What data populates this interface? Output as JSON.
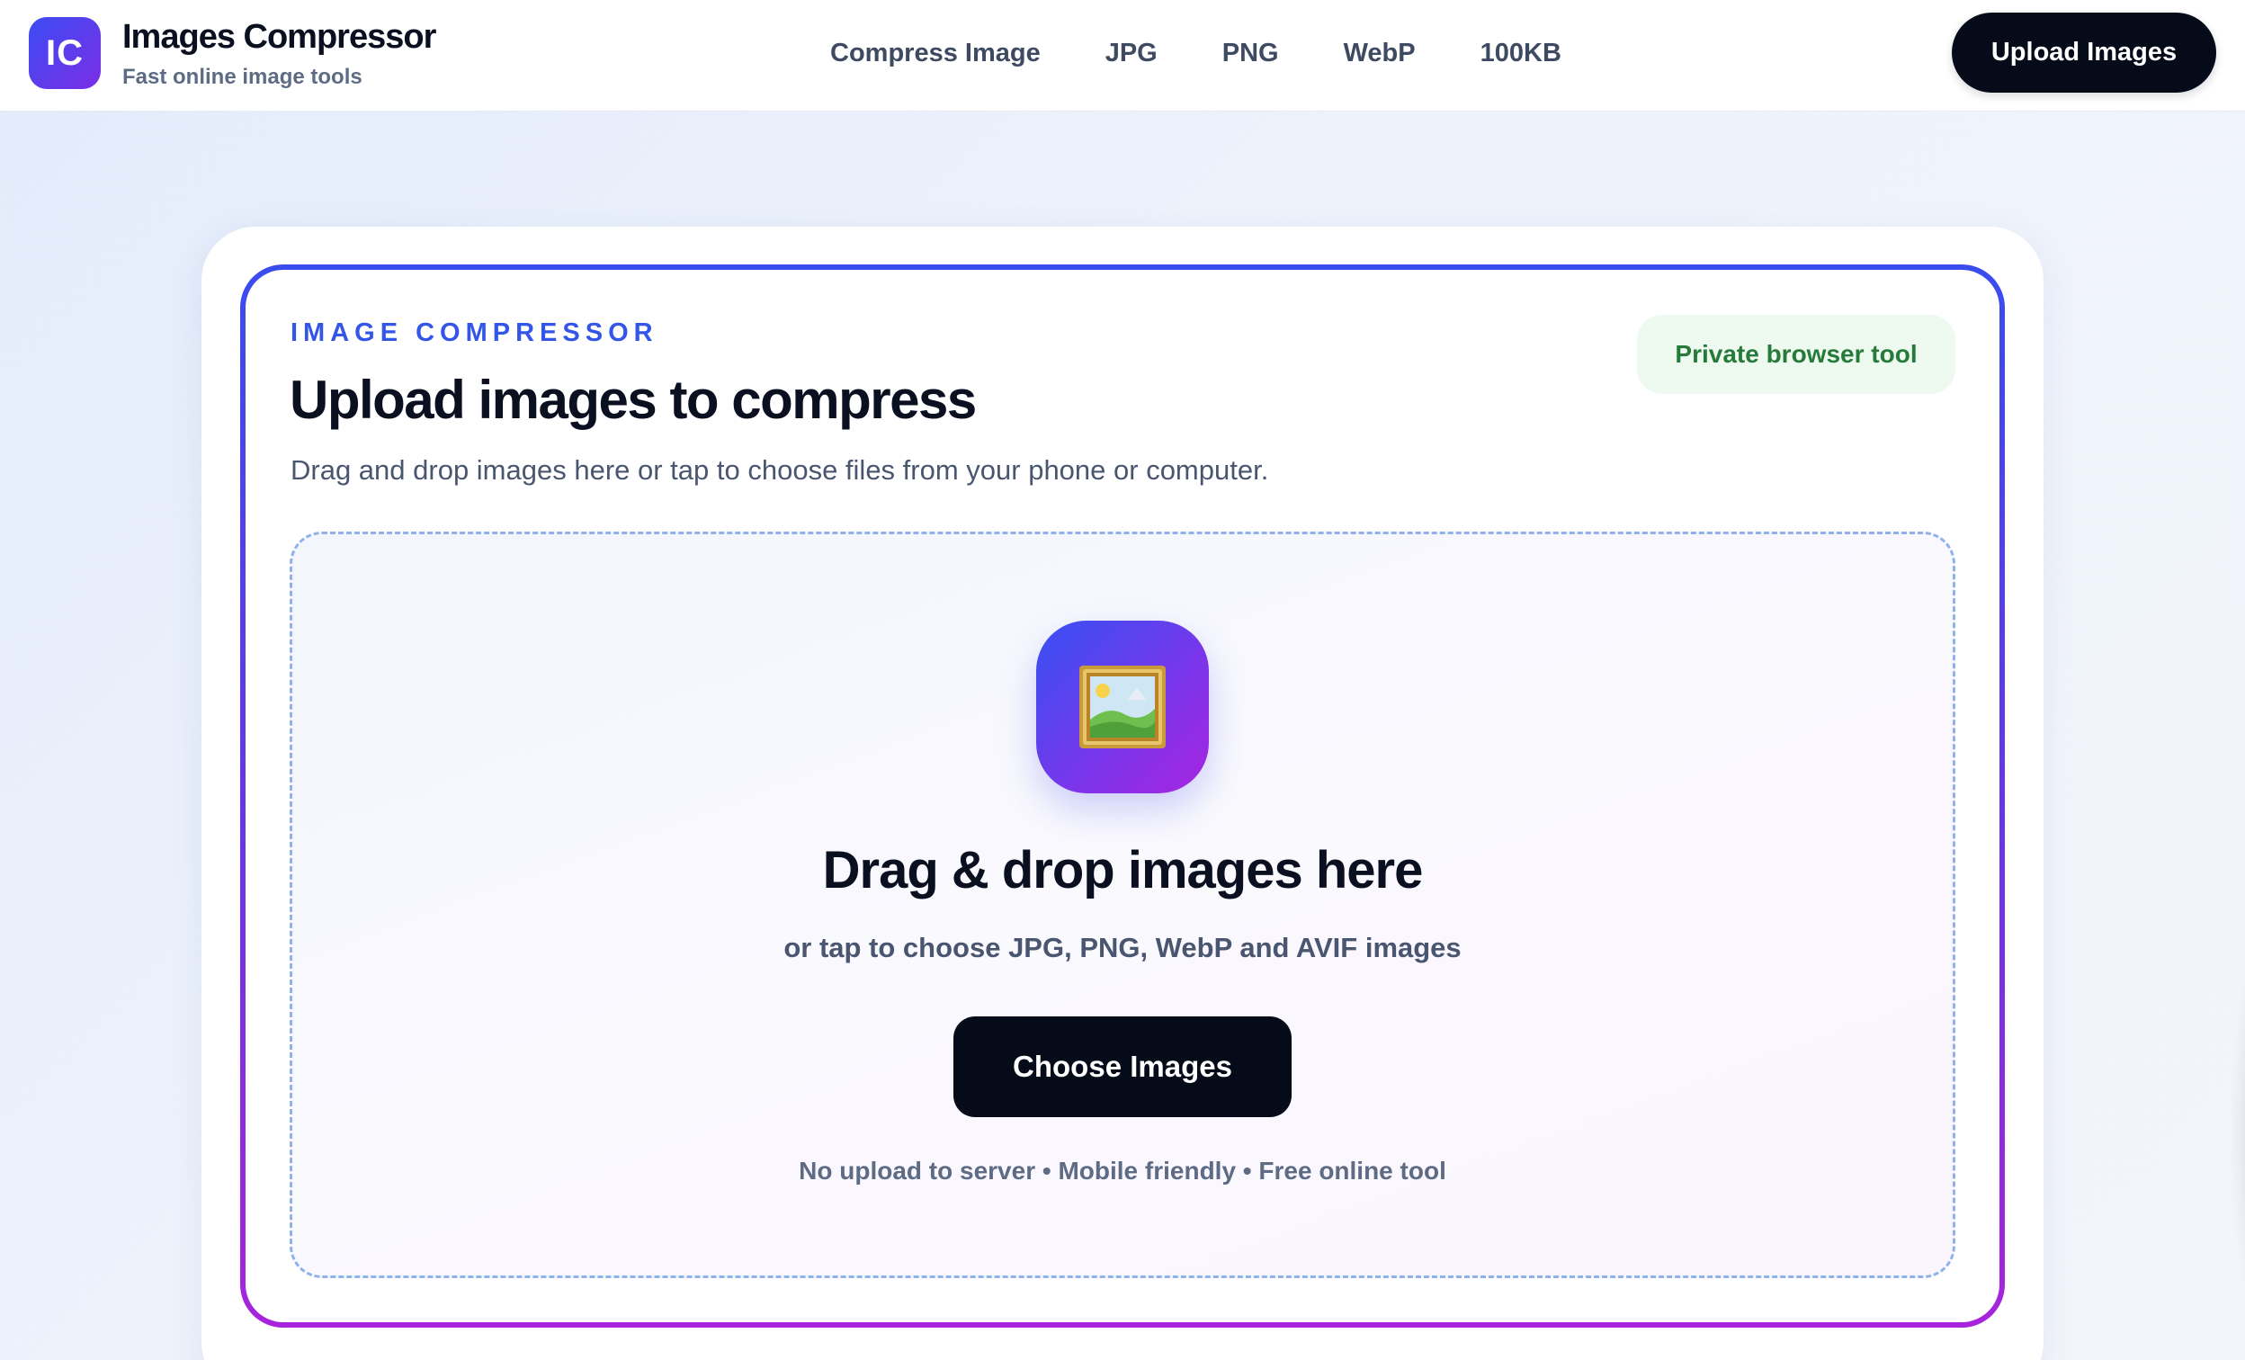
{
  "header": {
    "logo_text": "IC",
    "brand_title": "Images Compressor",
    "brand_subtitle": "Fast online image tools",
    "nav": [
      {
        "label": "Compress Image"
      },
      {
        "label": "JPG"
      },
      {
        "label": "PNG"
      },
      {
        "label": "WebP"
      },
      {
        "label": "100KB"
      }
    ],
    "upload_button": "Upload Images"
  },
  "main": {
    "eyebrow": "IMAGE COMPRESSOR",
    "heading": "Upload images to compress",
    "description": "Drag and drop images here or tap to choose files from your phone or computer.",
    "badge": "Private browser tool",
    "dropzone": {
      "icon": "framed-picture-icon",
      "title": "Drag & drop images here",
      "subtitle": "or tap to choose JPG, PNG, WebP and AVIF images",
      "button": "Choose Images",
      "footnote": "No upload to server • Mobile friendly • Free online tool"
    }
  },
  "colors": {
    "accent": "#3356e8",
    "gradient_start": "#3a4cf0",
    "gradient_end": "#a824dc",
    "dark_button": "#060b1a",
    "badge_text": "#267a3a",
    "badge_bg": "#eefaf0"
  }
}
